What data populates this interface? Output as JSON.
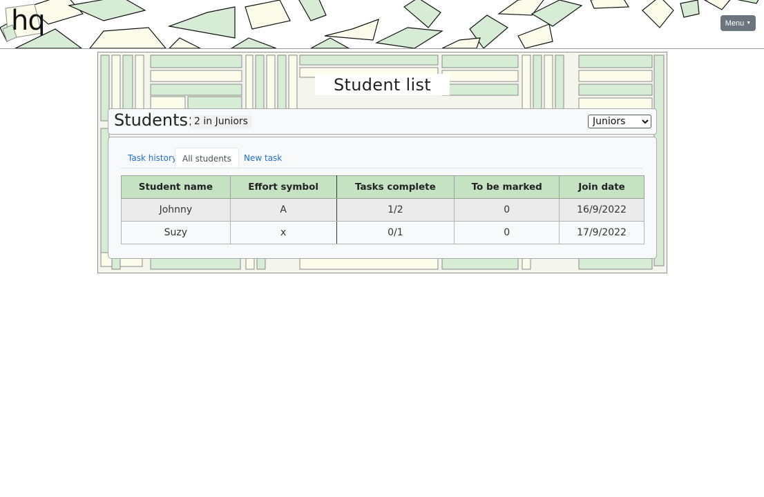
{
  "header": {
    "logo_text": "hq",
    "menu_label": "Menu"
  },
  "page": {
    "title": "Student list"
  },
  "students_bar": {
    "label": "Students:",
    "count_text": "2 in Juniors",
    "group_options": [
      "Juniors"
    ],
    "selected_group": "Juniors"
  },
  "tabs": [
    {
      "label": "Task history",
      "active": false
    },
    {
      "label": "All students",
      "active": true
    },
    {
      "label": "New task",
      "active": false
    }
  ],
  "table": {
    "columns": [
      "Student name",
      "Effort symbol",
      "Tasks complete",
      "To be marked",
      "Join date"
    ],
    "rows": [
      [
        "Johnny",
        "A",
        "1/2",
        "0",
        "16/9/2022"
      ],
      [
        "Suzy",
        "x",
        "0/1",
        "0",
        "17/9/2022"
      ]
    ]
  },
  "colors": {
    "paper_green": "#d6ecd4",
    "paper_cream": "#fbfcea",
    "table_header": "#c5e2c3",
    "menu_button": "#6c757d",
    "tab_link": "#1f6fd1"
  },
  "icons": {
    "menu_caret": "caret-down-icon"
  }
}
